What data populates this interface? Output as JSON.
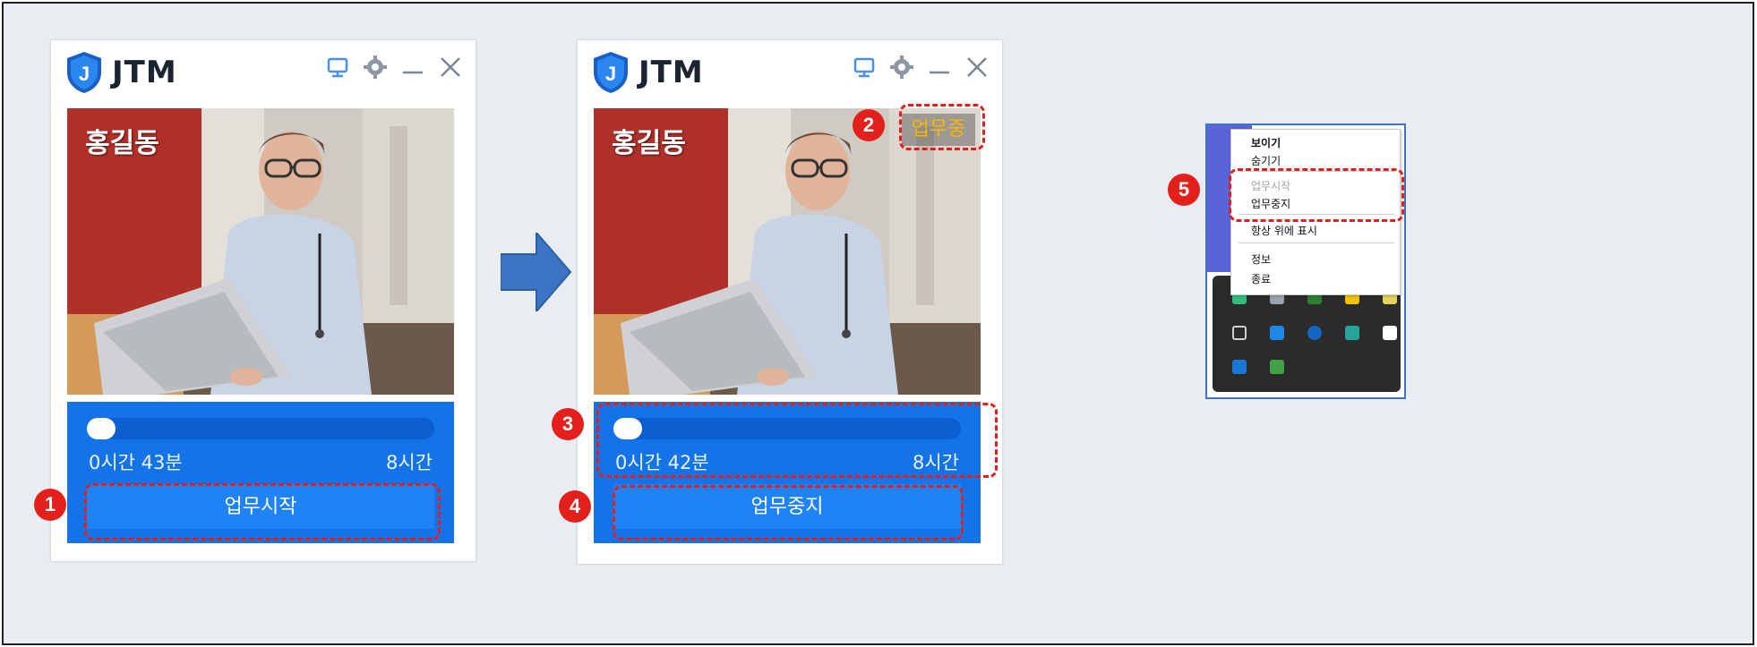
{
  "windows": [
    {
      "app_title": "JTM",
      "user_name": "홍길동",
      "status_badge": "",
      "elapsed": "0시간 43분",
      "total": "8시간",
      "progress": 0.09,
      "button_label": "업무시작"
    },
    {
      "app_title": "JTM",
      "user_name": "홍길동",
      "status_badge": "업무중",
      "elapsed": "0시간 42분",
      "total": "8시간",
      "progress": 0.09,
      "button_label": "업무중지"
    }
  ],
  "markers": [
    "1",
    "2",
    "3",
    "4",
    "5"
  ],
  "tray_menu": {
    "items": [
      {
        "label": "보이기",
        "enabled": true
      },
      {
        "label": "숨기기",
        "enabled": true
      },
      {
        "label": "업무시작",
        "enabled": false
      },
      {
        "label": "업무중지",
        "enabled": true
      },
      {
        "label": "항상 위에 표시",
        "enabled": true
      },
      {
        "label": "정보",
        "enabled": true
      },
      {
        "label": "종료",
        "enabled": true
      }
    ]
  },
  "icons": [
    "shield-logo-icon",
    "monitor-icon",
    "gear-icon",
    "minimize-icon",
    "close-icon",
    "arrow-right-icon"
  ],
  "colors": {
    "accent_blue": "#1473e6",
    "highlight_red": "#e0201e",
    "status_amber": "#f7b500",
    "canvas_bg": "#e9edf2"
  }
}
